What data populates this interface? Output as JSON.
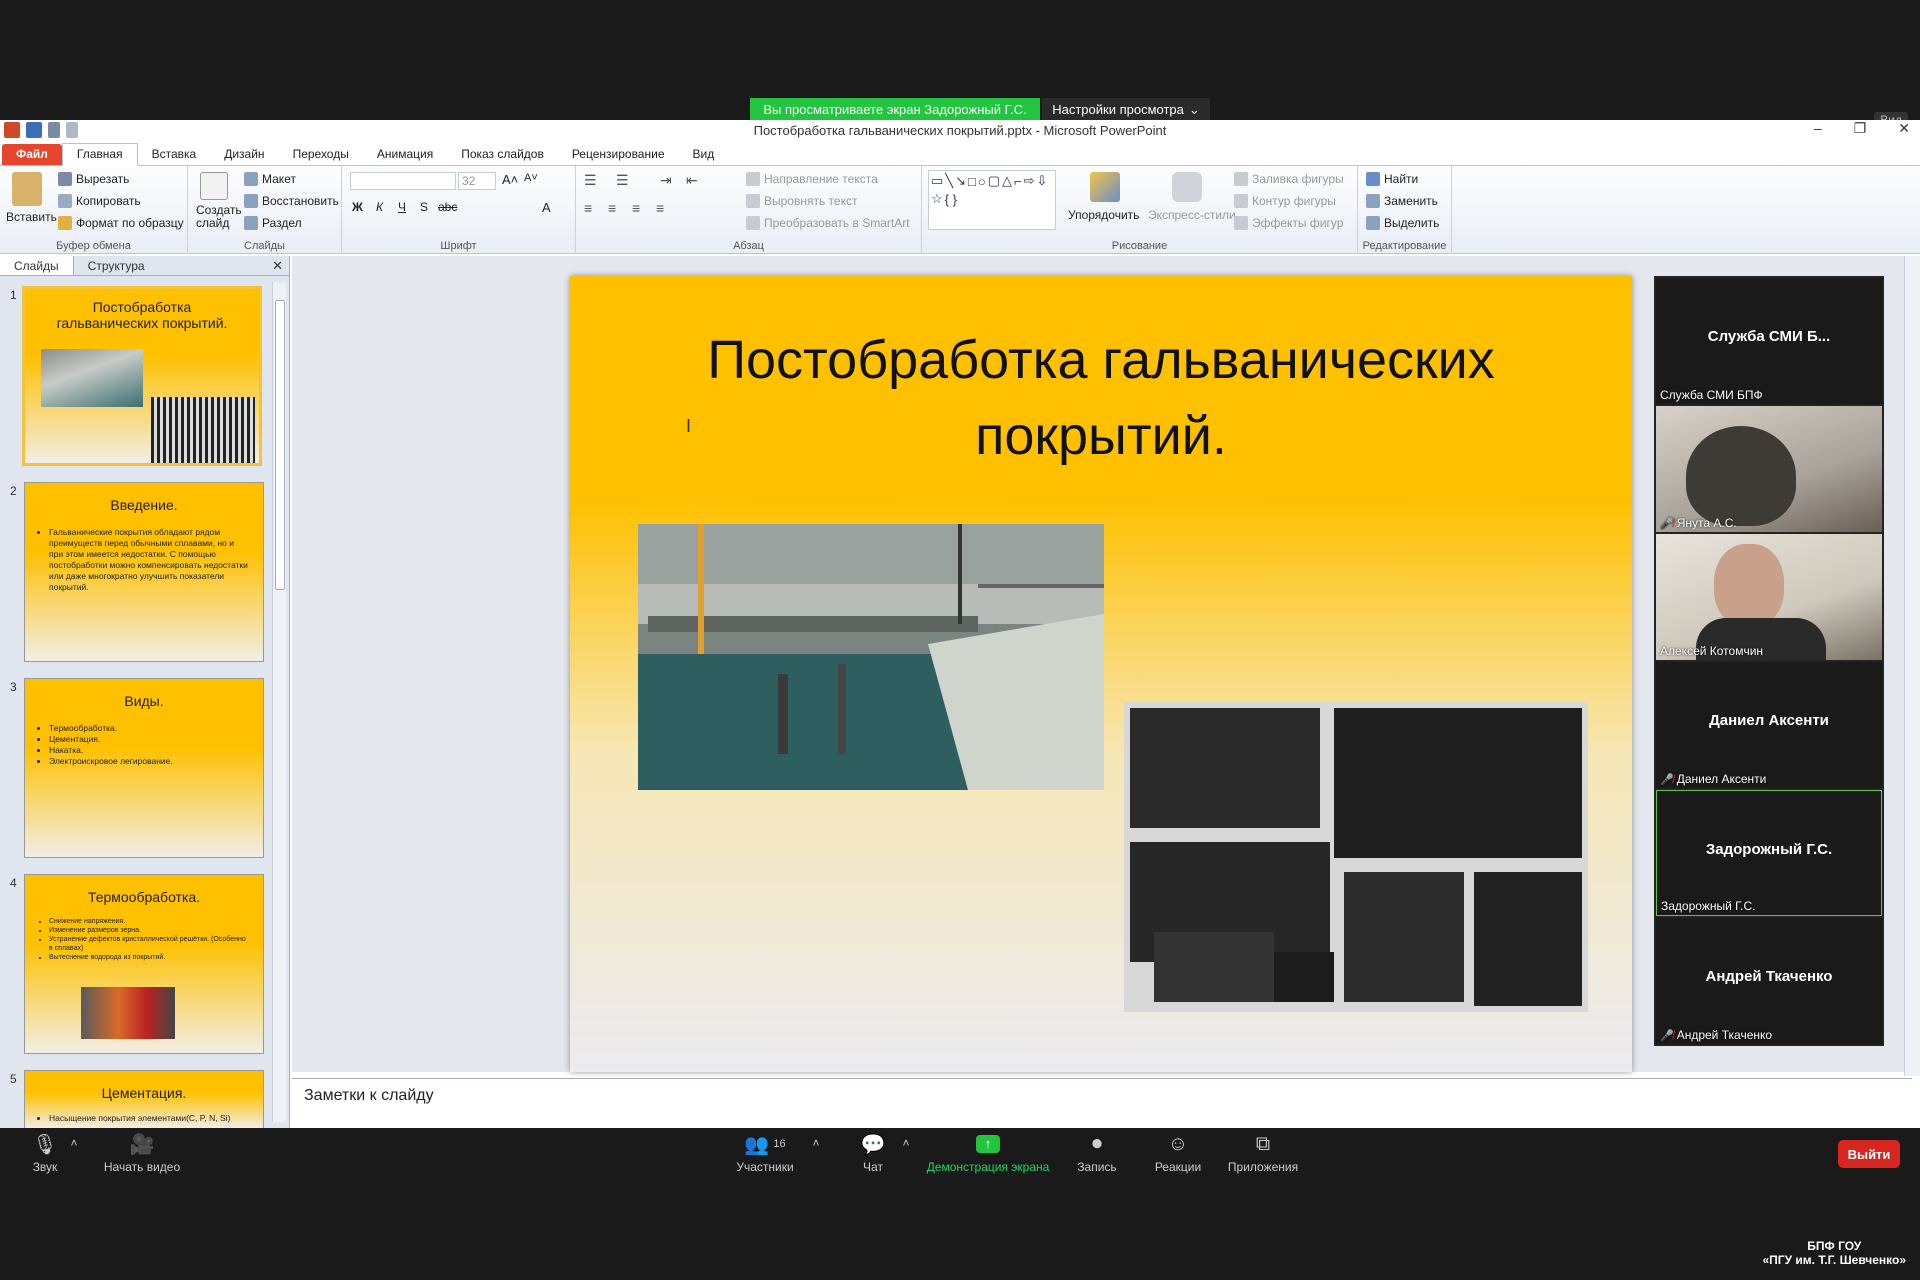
{
  "zoom_top": {
    "share_banner": "Вы просматриваете экран Задорожный Г.С.",
    "view_settings": "Настройки просмотра",
    "view_label": "Вид"
  },
  "window": {
    "title": "Постобработка гальванических покрытий.pptx  -  Microsoft PowerPoint",
    "minimize": "–",
    "restore": "❐",
    "close": "✕"
  },
  "ribbon_tabs": [
    "Файл",
    "Главная",
    "Вставка",
    "Дизайн",
    "Переходы",
    "Анимация",
    "Показ слайдов",
    "Рецензирование",
    "Вид"
  ],
  "ribbon": {
    "clipboard": {
      "paste": "Вставить",
      "cut": "Вырезать",
      "copy": "Копировать",
      "format": "Формат по образцу",
      "label": "Буфер обмена"
    },
    "slides": {
      "new_slide": "Создать слайд",
      "layout": "Макет",
      "reset": "Восстановить",
      "section": "Раздел",
      "label": "Слайды"
    },
    "font": {
      "size": "32",
      "label": "Шрифт",
      "bold": "Ж",
      "italic": "К",
      "underline": "Ч",
      "shadow": "S",
      "strike": "abc"
    },
    "paragraph": {
      "text_dir": "Направление текста",
      "align_text": "Выровнять текст",
      "smartart": "Преобразовать в SmartArt",
      "label": "Абзац"
    },
    "drawing": {
      "arrange": "Упорядочить",
      "quick_styles": "Экспресс-стили",
      "fill": "Заливка фигуры",
      "outline": "Контур фигуры",
      "effects": "Эффекты фигур",
      "label": "Рисование"
    },
    "editing": {
      "find": "Найти",
      "replace": "Заменить",
      "select": "Выделить",
      "label": "Редактирование"
    }
  },
  "pane_tabs": [
    "Слайды",
    "Структура"
  ],
  "thumbnails": [
    {
      "num": "1",
      "title": "Постобработка гальванических покрытий."
    },
    {
      "num": "2",
      "title": "Введение.",
      "body": "Гальванические покрытия обладают рядом преимуществ перед обычными сплавами, но и при этом имеется недостатки. С помощью постобработки можно компенсировать недостатки или даже многократно улучшить показатели покрытий."
    },
    {
      "num": "3",
      "title": "Виды.",
      "bullets": [
        "Термообработка.",
        "Цементация.",
        "Накатка.",
        "Электроискровое легирование."
      ]
    },
    {
      "num": "4",
      "title": "Термообработка.",
      "bullets": [
        "Снижение напряжения.",
        "Изменение размеров зерна.",
        "Устранение дефектов кристаллической решётки. (Особенно в сплавах)",
        "Вытеснение водорода из покрытий."
      ]
    },
    {
      "num": "5",
      "title": "Цементация.",
      "bullets": [
        "Насыщение покрытия элементами(C, P, N, Si)"
      ]
    }
  ],
  "slide": {
    "title_line1": "Постобработка гальванических",
    "title_line2": "покрытий."
  },
  "notes": "Заметки к слайду",
  "participants": [
    {
      "big": "Служба СМИ Б...",
      "label": "Служба СМИ БПФ",
      "muted": false
    },
    {
      "big": "",
      "label": "Янута А.С.",
      "muted": true,
      "video": true
    },
    {
      "big": "",
      "label": "Алексей Котомчин",
      "muted": false,
      "video": true
    },
    {
      "big": "Даниел Аксенти",
      "label": "Даниел Аксенти",
      "muted": true
    },
    {
      "big": "Задорожный Г.С.",
      "label": "Задорожный Г.С.",
      "muted": false,
      "active": true
    },
    {
      "big": "Андрей Ткаченко",
      "label": "Андрей Ткаченко",
      "muted": true
    }
  ],
  "zoom_bar": {
    "audio": "Звук",
    "video": "Начать видео",
    "participants": "Участники",
    "participants_count": "16",
    "chat": "Чат",
    "share": "Демонстрация экрана",
    "record": "Запись",
    "reactions": "Реакции",
    "apps": "Приложения",
    "leave": "Выйти"
  },
  "watermark": {
    "line1": "БПФ ГОУ",
    "line2": "«ПГУ им. Т.Г. Шевченко»"
  },
  "colors": {
    "slide_bg": "#ffc000",
    "share_green": "#23c43f",
    "leave_red": "#d7261f",
    "file_tab": "#e6462e"
  }
}
